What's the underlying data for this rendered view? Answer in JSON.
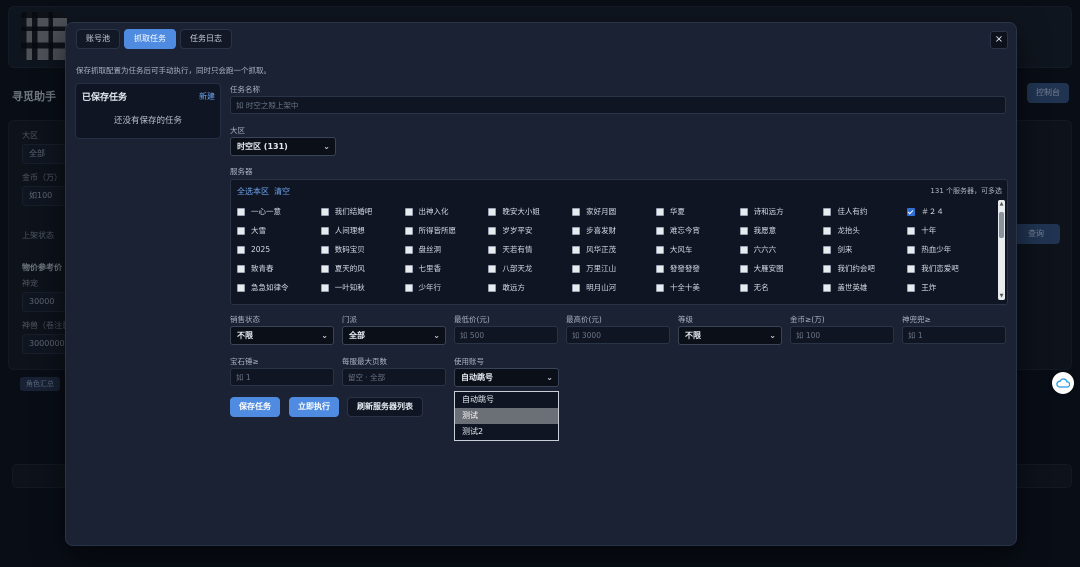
{
  "background": {
    "brand": "寻觅助手",
    "console_button": "控制台",
    "region_label": "大区",
    "region_value": "全部",
    "gold_label": "金币（万）",
    "gold_value": "如100",
    "listing_label": "上架状态",
    "ref_label": "物价参考价",
    "shen_label": "神宠",
    "shen_value": "30000",
    "other_label": "神兽（卷注意）",
    "other_value": "3000000",
    "query_button": "查询",
    "tag": "角色汇总"
  },
  "modal": {
    "tabs": [
      {
        "label": "账号池",
        "active": false
      },
      {
        "label": "抓取任务",
        "active": true
      },
      {
        "label": "任务日志",
        "active": false
      }
    ],
    "close": "×",
    "hint": "保存抓取配置为任务后可手动执行，同时只会跑一个抓取。",
    "saved": {
      "title": "已保存任务",
      "new": "新建",
      "empty": "还没有保存的任务"
    },
    "form": {
      "task_name_label": "任务名称",
      "task_name_placeholder": "如 时空之隙上架中",
      "region_label": "大区",
      "region_value": "时空区 (131)",
      "server_label": "服务器",
      "select_all": "全选本区",
      "clear": "清空",
      "server_count": "131 个服务器，可多选",
      "servers": [
        {
          "name": "一心一意",
          "checked": false
        },
        {
          "name": "我们结婚吧",
          "checked": false
        },
        {
          "name": "出神入化",
          "checked": false
        },
        {
          "name": "晚安大小姐",
          "checked": false
        },
        {
          "name": "家好月圆",
          "checked": false
        },
        {
          "name": "华夏",
          "checked": false
        },
        {
          "name": "诗和远方",
          "checked": false
        },
        {
          "name": "佳人有约",
          "checked": false
        },
        {
          "name": "＃２４",
          "checked": true
        },
        {
          "name": "大雪",
          "checked": false
        },
        {
          "name": "人间理想",
          "checked": false
        },
        {
          "name": "所得皆所愿",
          "checked": false
        },
        {
          "name": "岁岁平安",
          "checked": false
        },
        {
          "name": "步喜发财",
          "checked": false
        },
        {
          "name": "难忘今宵",
          "checked": false
        },
        {
          "name": "我愿意",
          "checked": false
        },
        {
          "name": "龙抬头",
          "checked": false
        },
        {
          "name": "十年",
          "checked": false
        },
        {
          "name": "2025",
          "checked": false
        },
        {
          "name": "数码宝贝",
          "checked": false
        },
        {
          "name": "盘丝洞",
          "checked": false
        },
        {
          "name": "天若有情",
          "checked": false
        },
        {
          "name": "风华正茂",
          "checked": false
        },
        {
          "name": "大风车",
          "checked": false
        },
        {
          "name": "六六六",
          "checked": false
        },
        {
          "name": "剑来",
          "checked": false
        },
        {
          "name": "热血少年",
          "checked": false
        },
        {
          "name": "致青春",
          "checked": false
        },
        {
          "name": "夏天的风",
          "checked": false
        },
        {
          "name": "七里香",
          "checked": false
        },
        {
          "name": "八部天龙",
          "checked": false
        },
        {
          "name": "万里江山",
          "checked": false
        },
        {
          "name": "發發發發",
          "checked": false
        },
        {
          "name": "大雁安图",
          "checked": false
        },
        {
          "name": "我们约会吧",
          "checked": false
        },
        {
          "name": "我们恋爱吧",
          "checked": false
        },
        {
          "name": "急急如律令",
          "checked": false
        },
        {
          "name": "一叶知秋",
          "checked": false
        },
        {
          "name": "少年行",
          "checked": false
        },
        {
          "name": "敢远方",
          "checked": false
        },
        {
          "name": "明月山河",
          "checked": false
        },
        {
          "name": "十全十美",
          "checked": false
        },
        {
          "name": "无名",
          "checked": false
        },
        {
          "name": "盖世英雄",
          "checked": false
        },
        {
          "name": "王炸",
          "checked": false
        },
        {
          "name": "",
          "checked": false
        },
        {
          "name": "",
          "checked": false
        },
        {
          "name": "",
          "checked": false
        },
        {
          "name": "",
          "checked": false
        },
        {
          "name": "",
          "checked": false
        },
        {
          "name": "",
          "checked": false
        },
        {
          "name": "",
          "checked": false
        },
        {
          "name": "",
          "checked": false
        },
        {
          "name": "",
          "checked": false
        }
      ],
      "sale_status_label": "销售状态",
      "sale_status_value": "不限",
      "sect_label": "门派",
      "sect_value": "全部",
      "min_price_label": "最低价(元)",
      "min_price_placeholder": "如 500",
      "max_price_label": "最高价(元)",
      "max_price_placeholder": "如 3000",
      "level_label": "等级",
      "level_value": "不限",
      "gold_label": "金币≥(万)",
      "gold_placeholder": "如 100",
      "pet_label": "神兜兜≥",
      "pet_placeholder": "如 1",
      "gem_label": "宝石锤≥",
      "gem_placeholder": "如 1",
      "pages_label": "每服最大页数",
      "pages_placeholder": "留空 · 全部",
      "account_label": "使用账号",
      "account_value": "自动跳号",
      "account_options": [
        "自动跳号",
        "测试",
        "测试2"
      ],
      "save_button": "保存任务",
      "run_button": "立即执行",
      "refresh_button": "刷新服务器列表"
    }
  }
}
